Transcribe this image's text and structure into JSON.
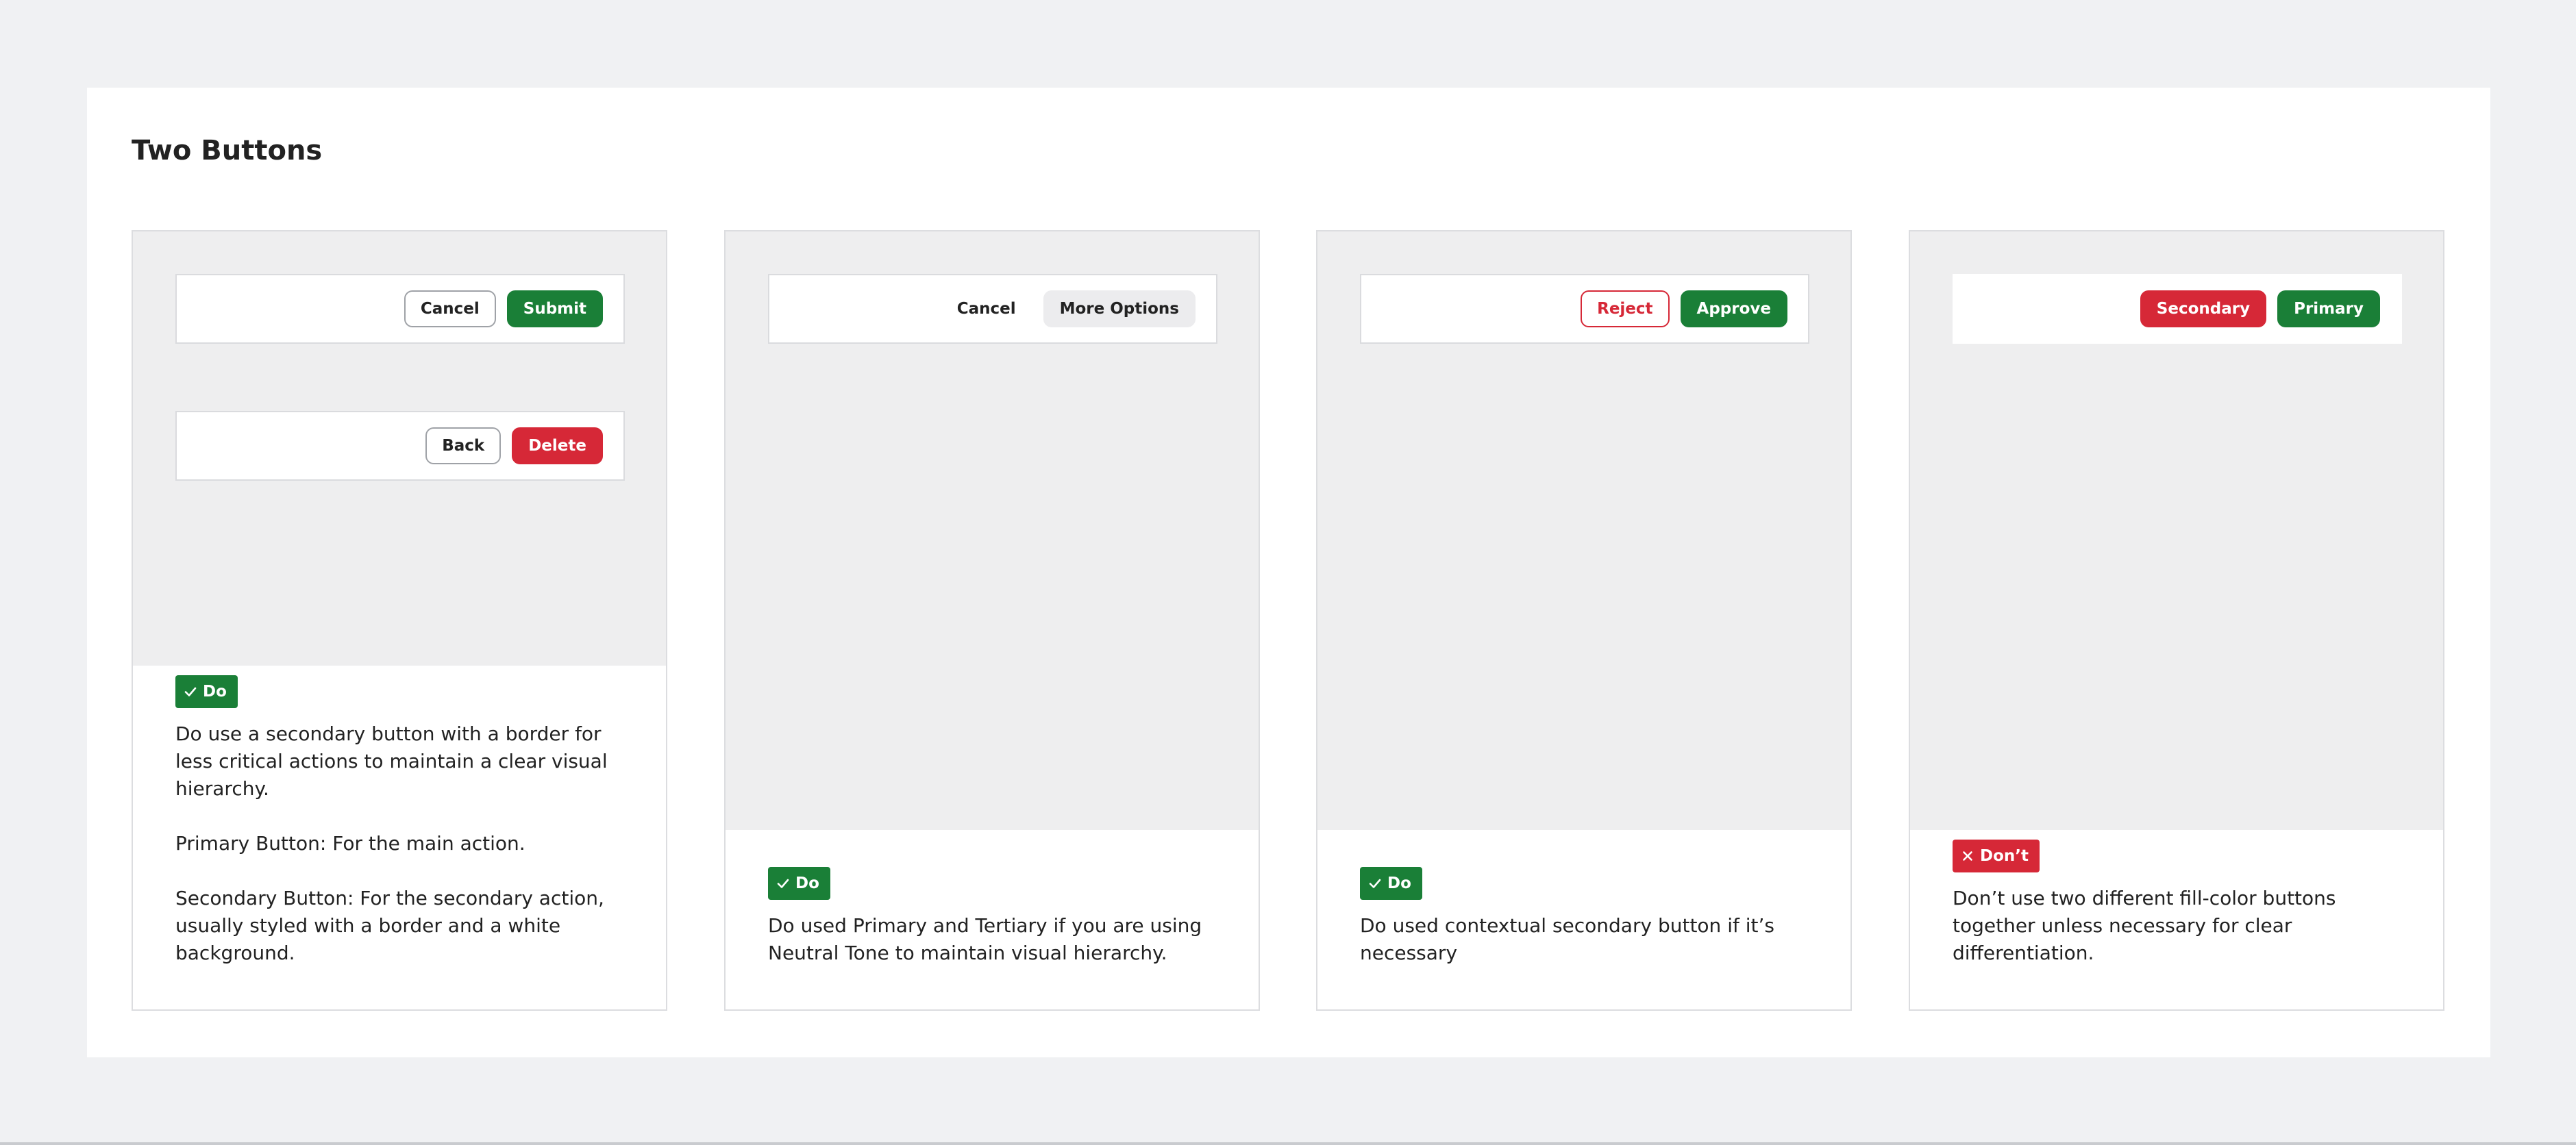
{
  "title": "Two Buttons",
  "colors": {
    "primary_green": "#1a7f37",
    "danger_red": "#d62837",
    "preview_bg": "#eeeeef",
    "page_bg": "#f0f1f3"
  },
  "cards": [
    {
      "badge": {
        "label": "Do",
        "icon": "check-icon"
      },
      "examples": [
        {
          "secondary": "Cancel",
          "primary": "Submit"
        },
        {
          "secondary": "Back",
          "primary": "Delete"
        }
      ],
      "paragraphs": [
        "Do use a secondary button with a border for less critical actions to maintain a clear visual hierarchy.",
        "Primary Button: For the main action.",
        "Secondary Button: For the secondary action, usually styled with a border and a white background."
      ]
    },
    {
      "badge": {
        "label": "Do",
        "icon": "check-icon"
      },
      "examples": [
        {
          "tertiary": "Cancel",
          "neutral": "More Options"
        }
      ],
      "paragraphs": [
        "Do used Primary and Tertiary if you are using Neutral Tone to maintain visual hierarchy."
      ]
    },
    {
      "badge": {
        "label": "Do",
        "icon": "check-icon"
      },
      "examples": [
        {
          "secondary": "Reject",
          "primary": "Approve"
        }
      ],
      "paragraphs": [
        "Do used contextual secondary button if it’s necessary"
      ]
    },
    {
      "badge": {
        "label": "Don’t",
        "icon": "x-icon"
      },
      "examples": [
        {
          "secondary": "Secondary",
          "primary": "Primary"
        }
      ],
      "paragraphs": [
        "Don’t use two different fill-color buttons together unless necessary for clear differentiation."
      ]
    }
  ]
}
